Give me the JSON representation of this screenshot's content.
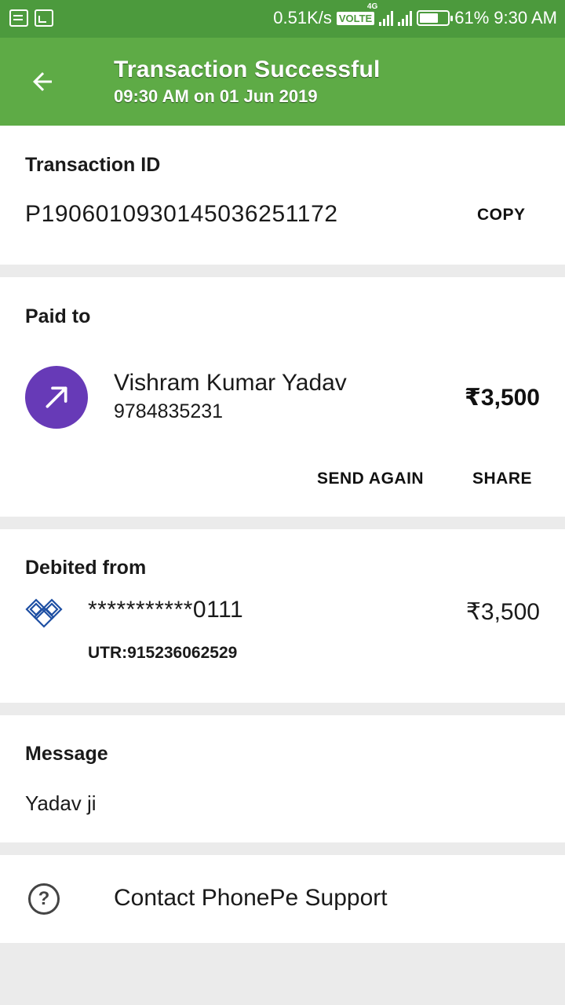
{
  "status_bar": {
    "net_speed": "0.51K/s",
    "volte": "VOLTE",
    "network": "4G",
    "battery": "61%",
    "time": "9:30 AM"
  },
  "header": {
    "title": "Transaction Successful",
    "subtitle": "09:30 AM on 01 Jun 2019",
    "back_icon": "arrow-left-icon",
    "color": "#5eab46"
  },
  "transaction": {
    "label": "Transaction ID",
    "id": "P1906010930145036251172",
    "copy_label": "COPY"
  },
  "paid_to": {
    "label": "Paid to",
    "name": "Vishram Kumar Yadav",
    "phone": "9784835231",
    "amount": "₹3,500",
    "avatar_icon": "arrow-up-right-icon",
    "avatar_color": "#673ab7",
    "send_again_label": "SEND AGAIN",
    "share_label": "SHARE"
  },
  "debited_from": {
    "label": "Debited from",
    "account": "***********0111",
    "utr": "UTR:915236062529",
    "amount": "₹3,500",
    "bank_icon": "bank-logo-icon"
  },
  "message": {
    "label": "Message",
    "text": "Yadav ji"
  },
  "support": {
    "label": "Contact PhonePe Support",
    "icon": "help-circle-icon"
  }
}
